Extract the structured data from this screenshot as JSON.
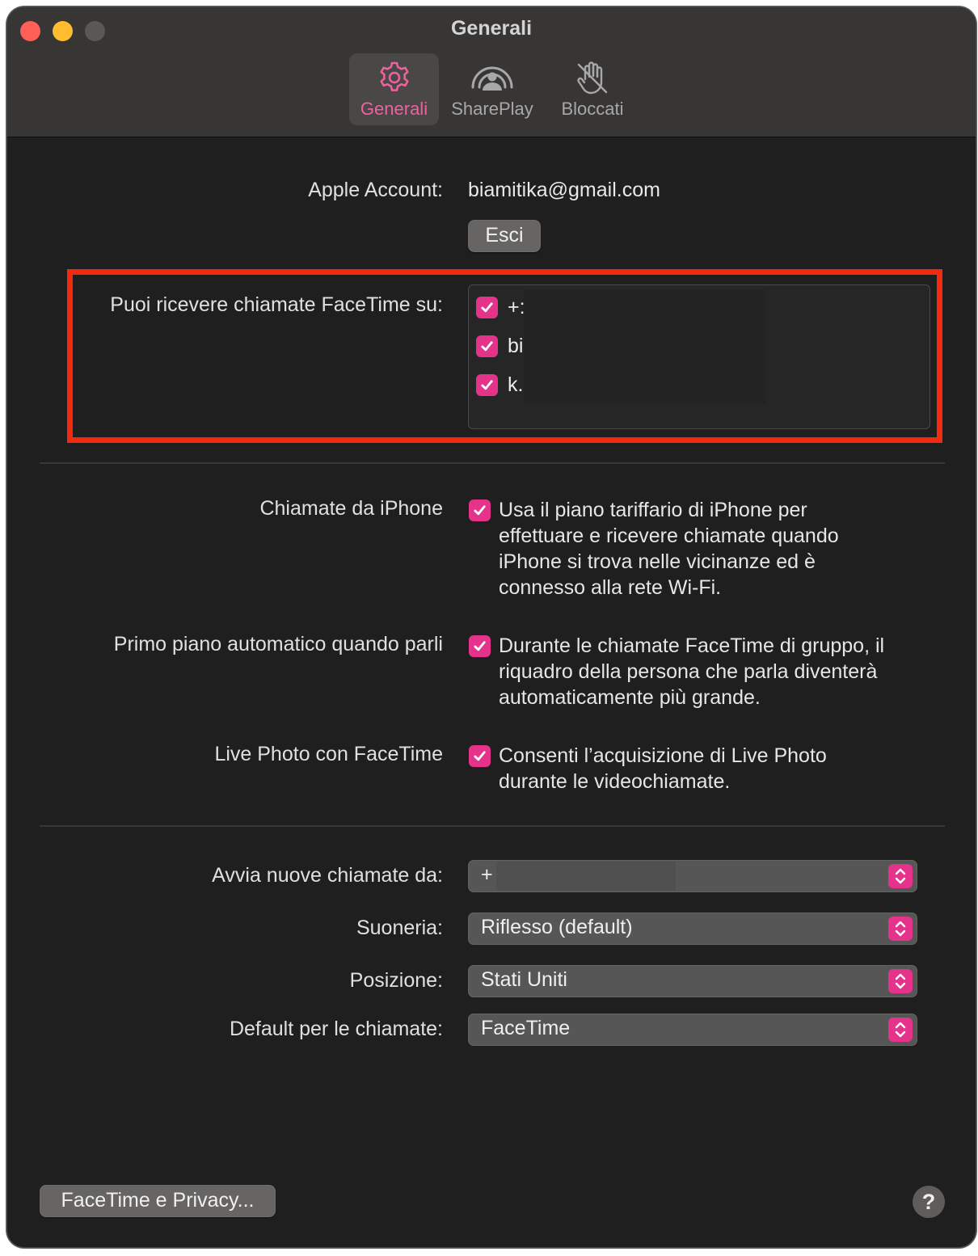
{
  "window": {
    "title": "Generali"
  },
  "tabs": [
    {
      "label": "Generali",
      "icon": "gear-icon",
      "active": true
    },
    {
      "label": "SharePlay",
      "icon": "shareplay-icon",
      "active": false
    },
    {
      "label": "Bloccati",
      "icon": "blocked-hand-icon",
      "active": false
    }
  ],
  "account": {
    "label": "Apple Account:",
    "email": "biamitika@gmail.com",
    "signout_label": "Esci"
  },
  "reachable": {
    "label": "Puoi ricevere chiamate FaceTime su:",
    "items": [
      {
        "text": "+:",
        "checked": true
      },
      {
        "text": "bi",
        "checked": true
      },
      {
        "text": "k.",
        "checked": true
      }
    ]
  },
  "options": [
    {
      "label": "Chiamate da iPhone",
      "checked": true,
      "lines": [
        "Usa il piano tariffario di iPhone per",
        "effettuare e ricevere chiamate quando",
        "iPhone si trova nelle vicinanze ed è",
        "connesso alla rete Wi-Fi."
      ]
    },
    {
      "label": "Primo piano automatico quando parli",
      "checked": true,
      "lines": [
        "Durante le chiamate FaceTime di gruppo, il",
        "riquadro della persona che parla diventerà",
        "automaticamente più grande."
      ]
    },
    {
      "label": "Live Photo con FaceTime",
      "checked": true,
      "lines": [
        "Consenti l’acquisizione di Live Photo",
        "durante le videochiamate."
      ]
    }
  ],
  "popups": [
    {
      "label": "Avvia nuove chiamate da:",
      "value": "+"
    },
    {
      "label": "Suoneria:",
      "value": "Riflesso (default)"
    },
    {
      "label": "Posizione:",
      "value": "Stati Uniti"
    },
    {
      "label": "Default per le chiamate:",
      "value": "FaceTime"
    }
  ],
  "footer": {
    "privacy_label": "FaceTime e Privacy...",
    "help_label": "?"
  },
  "colors": {
    "accent": "#e5328a",
    "highlight_border": "#f42a10",
    "window_bg": "#1f1f1f",
    "titlebar_bg": "#383635"
  }
}
